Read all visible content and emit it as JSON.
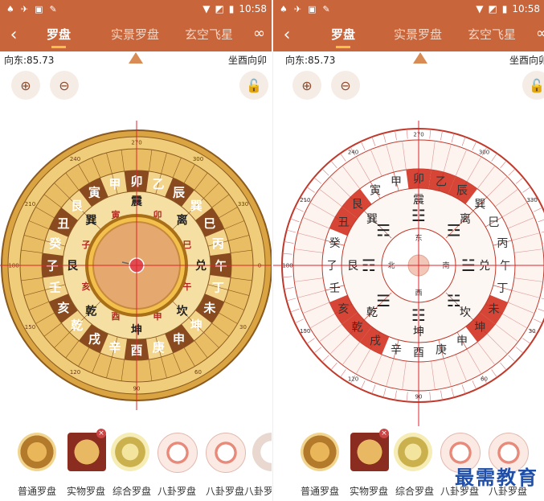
{
  "status": {
    "icons": [
      "♠",
      "✈",
      "▣",
      "✎"
    ],
    "time": "10:58",
    "wifi": "▼",
    "signal": "◩",
    "battery": "▮"
  },
  "appbar": {
    "back": "‹",
    "tabs": [
      "罗盘",
      "实景罗盘",
      "玄空飞星"
    ],
    "active": 0,
    "loop": "∞"
  },
  "readout": {
    "direction": "向东:85.73",
    "sitting": "坐酉向卯"
  },
  "controls": {
    "zoom_in": "⊕",
    "zoom_out": "⊖",
    "lock": "🔓"
  },
  "colors": {
    "bar": "#c8653a",
    "accent": "#f6c04a",
    "red_line": "#e0232b",
    "gold": "#d9a441",
    "brown": "#8a4a1f",
    "red_seg": "#d64535"
  },
  "compass_left": {
    "outer_ring": [
      "戌",
      "乾",
      "亥",
      "壬",
      "子",
      "癸",
      "丑",
      "艮",
      "寅",
      "甲",
      "卯",
      "乙",
      "辰",
      "巽",
      "巳",
      "丙",
      "午",
      "丁",
      "未",
      "坤",
      "申",
      "庚",
      "酉",
      "辛"
    ],
    "trigrams": [
      "震",
      "离",
      "兑",
      "坎",
      "坤",
      "乾",
      "艮",
      "巽"
    ],
    "branches": [
      "卯",
      "巳",
      "午",
      "申",
      "酉",
      "亥",
      "子",
      "寅"
    ],
    "degrees": [
      "270",
      "300",
      "330",
      "0",
      "30",
      "60",
      "90",
      "120",
      "150",
      "180",
      "210",
      "240"
    ]
  },
  "compass_right": {
    "outer_ring": [
      "戌",
      "乾",
      "亥",
      "壬",
      "子",
      "癸",
      "丑",
      "艮",
      "寅",
      "甲",
      "卯",
      "乙",
      "辰",
      "巽",
      "巳",
      "丙",
      "午",
      "丁",
      "未",
      "坤",
      "申",
      "庚",
      "酉",
      "辛"
    ],
    "trigrams": [
      "震",
      "离",
      "兑",
      "坎",
      "坤",
      "乾",
      "艮",
      "巽"
    ],
    "inner": [
      "东",
      "南",
      "西",
      "北"
    ],
    "degrees": [
      "270",
      "300",
      "330",
      "0",
      "30",
      "60",
      "90",
      "120",
      "150",
      "180",
      "210",
      "240"
    ]
  },
  "thumbnails_left": [
    {
      "label": "普通罗盘"
    },
    {
      "label": "实物罗盘"
    },
    {
      "label": "综合罗盘"
    },
    {
      "label": "八卦罗盘"
    },
    {
      "label": "八卦罗盘"
    },
    {
      "label": "八卦罗"
    }
  ],
  "thumbnails_right": [
    {
      "label": "普通罗盘"
    },
    {
      "label": "实物罗盘"
    },
    {
      "label": "综合罗盘"
    },
    {
      "label": "八卦罗盘"
    },
    {
      "label": "八卦罗盘"
    }
  ],
  "badge": "×",
  "watermark": "最需教育"
}
